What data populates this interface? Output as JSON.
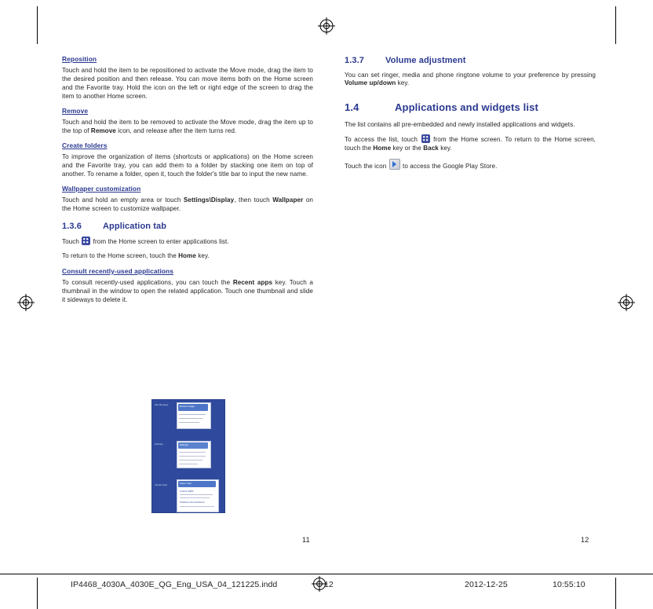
{
  "document": {
    "left_column": {
      "blocks": [
        {
          "type": "subheading",
          "text": "Reposition "
        },
        {
          "type": "paragraph",
          "text": "Touch and hold the item to be repositioned to activate the Move mode, drag the item to the desired position and then release. You can move items both on the Home screen and the Favorite tray. Hold the icon on the left or right edge of the screen to drag the item to another Home screen."
        },
        {
          "type": "subheading",
          "text": "Remove"
        },
        {
          "type": "paragraph_remove",
          "text_1": "Touch and hold the item to be removed to activate the Move mode, drag the item up to the top of ",
          "bold_1": "Remove",
          "text_2": " icon, and release after the item turns red."
        },
        {
          "type": "subheading",
          "text": "Create folders"
        },
        {
          "type": "paragraph",
          "text": "To improve the organization of items (shortcuts or applications) on the Home screen and the Favorite tray, you can add them to a folder by stacking one item on top of another. To rename a folder, open it, touch the folder's title bar to input the new name."
        },
        {
          "type": "subheading",
          "text": "Wallpaper customization"
        },
        {
          "type": "paragraph_wallpaper",
          "text_1": "Touch and hold an empty area or touch ",
          "bold_1": "Settings\\Display",
          "text_2": ", then touch ",
          "bold_2": "Wallpaper",
          "text_3": " on the Home screen to customize wallpaper."
        }
      ],
      "heading_136": {
        "number": "1.3.6",
        "title": "Application tab"
      },
      "para_app_tab_1": {
        "text_1": "Touch ",
        "icon": "app-drawer-icon",
        "text_2": " from the Home screen to enter applications list."
      },
      "para_app_tab_2": {
        "text_1": "To return to the Home screen, touch the ",
        "bold_1": "Home",
        "text_2": " key."
      },
      "subheading_recent": "Consult recently-used applications",
      "para_recent": {
        "text_1": "To consult recently-used applications, you can touch the ",
        "bold_1": "Recent apps",
        "text_2": " key. Touch a thumbnail in the window to open the related application. Touch one thumbnail and slide it sideways to delete it."
      }
    },
    "right_column": {
      "heading_137": {
        "number": "1.3.7",
        "title": "Volume adjustment"
      },
      "para_volume": {
        "text_1": "You can set ringer, media and phone ringtone volume to your preference by pressing ",
        "bold_1": "Volume up/down",
        "text_2": " key."
      },
      "heading_14": {
        "number": "1.4",
        "title": "Applications and widgets list"
      },
      "para_list": {
        "text": "The list contains all pre-embedded and newly installed applications and widgets."
      },
      "para_access": {
        "text_1": "To access the list, touch ",
        "icon": "app-drawer-icon",
        "text_2": " from the Home screen. To return to the Home screen, touch the ",
        "bold_1": "Home",
        "text_3": " key or the ",
        "bold_2": "Back",
        "text_4": " key."
      },
      "para_playstore": {
        "text_1": "Touch the icon ",
        "icon": "play-store-icon",
        "text_2": " to access the Google Play Store."
      }
    },
    "phone_screenshot": {
      "alt": "Android recent-apps screen showing File Manager, Settings and Alcatel Help thumbnails",
      "items": [
        {
          "label": "File Manager"
        },
        {
          "label": "Settings"
        },
        {
          "label": "Alcatel Help"
        }
      ],
      "cards": [
        {
          "title": "Recent Usage",
          "sub": "Notification"
        },
        {
          "title": "Settings",
          "sub": ""
        },
        {
          "title": "Super User",
          "sub": "Unlock SIMS"
        },
        {
          "title": "Problems And Solutions",
          "sub": ""
        }
      ]
    },
    "folios": {
      "left": "11",
      "right": "12"
    },
    "footer": {
      "filename": "IP4468_4030A_4030E_QG_Eng_USA_04_121225.indd",
      "page_marker": "12",
      "date": "2012-12-25",
      "time": "10:55:10"
    }
  }
}
